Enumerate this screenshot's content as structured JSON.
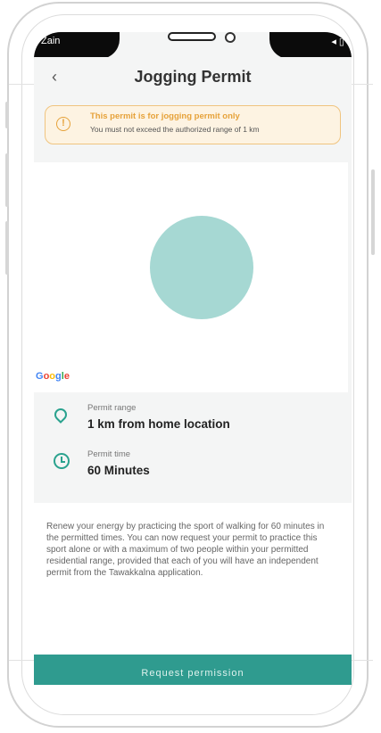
{
  "status_bar": {
    "carrier": "Zain",
    "right_text": "◂ ▯"
  },
  "header": {
    "title": "Jogging Permit",
    "back_label": "‹"
  },
  "notice": {
    "title": "This permit is for jogging permit only",
    "subtitle": "You must not exceed the authorized range of 1 km",
    "icon_glyph": "!"
  },
  "map": {
    "provider_label": "Google"
  },
  "permit_range": {
    "label": "Permit range",
    "value": "1 km from home location"
  },
  "permit_time": {
    "label": "Permit time",
    "value": "60 Minutes"
  },
  "description": "Renew your energy by practicing the sport of walking for 60 minutes in the permitted times. You can now request your permit to practice this sport alone or with a maximum of two people within your permitted residential range, provided that each of you will have an independent permit from the Tawakkalna application.",
  "request_button": "Request permission",
  "colors": {
    "accent": "#2f9b8f",
    "warning": "#e6a23a",
    "map_circle": "#a6d8d3"
  }
}
